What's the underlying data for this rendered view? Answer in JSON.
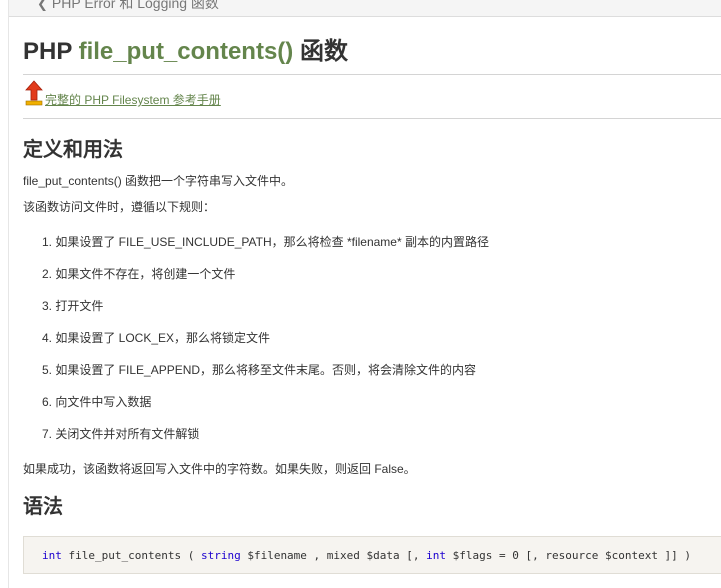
{
  "nav": {
    "prev_link": "PHP Error 和 Logging 函数"
  },
  "title": {
    "prefix": "PHP",
    "function": "file_put_contents()",
    "suffix": "函数"
  },
  "reference_link": "完整的 PHP Filesystem 参考手册",
  "definition": {
    "heading": "定义和用法",
    "intro": "file_put_contents() 函数把一个字符串写入文件中。",
    "rules_intro": "该函数访问文件时，遵循以下规则：",
    "rules": [
      "1. 如果设置了 FILE_USE_INCLUDE_PATH，那么将检查 *filename* 副本的内置路径",
      "2. 如果文件不存在，将创建一个文件",
      "3. 打开文件",
      "4. 如果设置了 LOCK_EX，那么将锁定文件",
      "5. 如果设置了 FILE_APPEND，那么将移至文件末尾。否则，将会清除文件的内容",
      "6. 向文件中写入数据",
      "7. 关闭文件并对所有文件解锁"
    ],
    "return_note": "如果成功，该函数将返回写入文件中的字符数。如果失败，则返回 False。"
  },
  "syntax": {
    "heading": "语法",
    "code": {
      "kw_int": "int",
      "fn_name": " file_put_contents ( ",
      "kw_string": "string",
      "params_1": " $filename , mixed $data [, ",
      "kw_int2": "int",
      "params_2": " $flags = 0 [, resource $context ]] )"
    }
  },
  "colors": {
    "function_green": "#64854c",
    "link_green": "#64854c",
    "code_bg": "#f6f4f0"
  },
  "icons": {
    "nav": "chevron-left-icon",
    "reference": "arrow-up-icon"
  }
}
